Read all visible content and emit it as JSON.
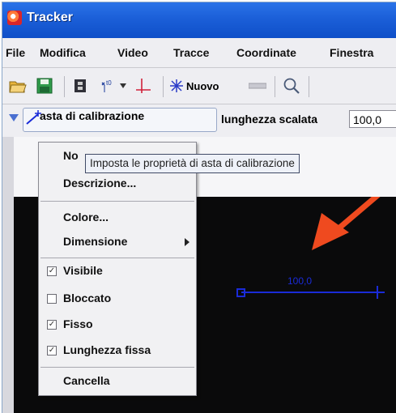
{
  "window": {
    "title": "Tracker"
  },
  "menubar": {
    "items": [
      {
        "label": "File"
      },
      {
        "label": "Modifica"
      },
      {
        "label": "Video"
      },
      {
        "label": "Tracce"
      },
      {
        "label": "Coordinate"
      },
      {
        "label": "Finestra"
      }
    ]
  },
  "toolbar": {
    "new_label": "Nuovo",
    "new_icon": "asterisk-icon"
  },
  "calibration_bar": {
    "track_label": "asta di calibrazione",
    "length_label": "lunghezza scalata",
    "length_value": "100,0"
  },
  "popup_menu": {
    "items": [
      {
        "label": "No"
      },
      {
        "label": "Descrizione..."
      },
      {
        "label": "Colore..."
      },
      {
        "label": "Dimensione"
      },
      {
        "label": "Visibile",
        "checked": true
      },
      {
        "label": "Bloccato",
        "checked": false
      },
      {
        "label": "Fisso",
        "checked": true
      },
      {
        "label": "Lunghezza fissa",
        "checked": true
      },
      {
        "label": "Cancella"
      }
    ]
  },
  "tooltip": {
    "text": "Imposta le proprietà di asta di calibrazione"
  },
  "video": {
    "calibration_stick_label": "100,0",
    "stick_color": "#1a2bd8",
    "arrow_color": "#ef4a1f"
  }
}
